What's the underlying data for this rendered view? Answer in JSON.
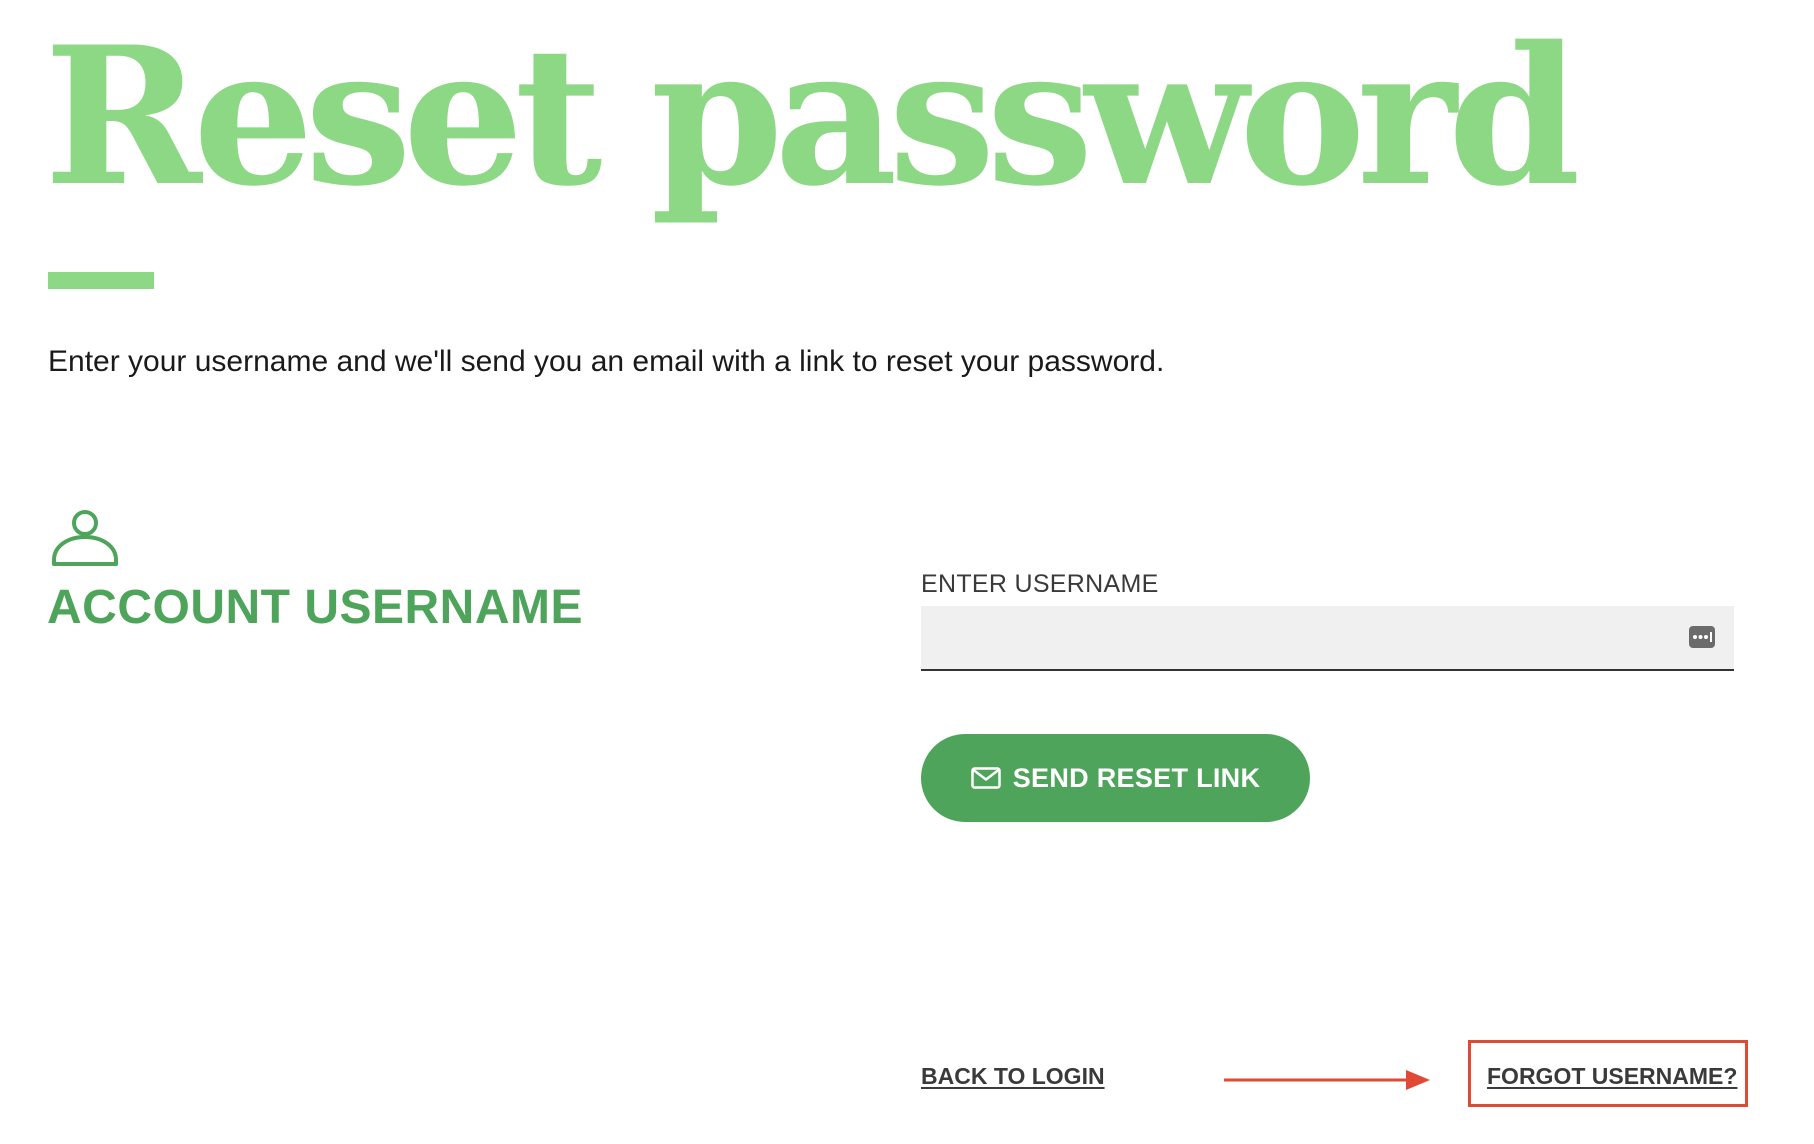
{
  "title": "Reset password",
  "intro": "Enter your username and we'll send you an email with a link to reset your password.",
  "section": {
    "heading": "ACCOUNT USERNAME",
    "icon": "person-icon"
  },
  "form": {
    "username_label": "ENTER USERNAME",
    "username_value": "",
    "username_placeholder": "",
    "autofill_icon": "password-key-icon",
    "submit_label": "SEND RESET LINK",
    "submit_icon": "mail-icon"
  },
  "footer": {
    "back_label": "BACK TO LOGIN",
    "forgot_label": "FORGOT USERNAME?"
  },
  "annotation": {
    "highlight": "forgot-username-link",
    "color": "#e04a35"
  },
  "colors": {
    "title": "#8cd884",
    "accent": "#4ea45a",
    "input_background": "#f0f0f0"
  }
}
